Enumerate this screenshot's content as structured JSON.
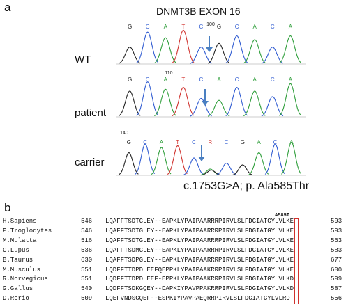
{
  "panel_a": {
    "letter": "a",
    "title": "DNMT3B EXON 16",
    "caption": "c.1753G>A; p. Ala585Thr",
    "traces": [
      {
        "label": "WT",
        "bases": [
          "G",
          "C",
          "A",
          "T",
          "C",
          "G",
          "C",
          "A",
          "C",
          "A"
        ],
        "position_marker": "100"
      },
      {
        "label": "patient",
        "bases": [
          "G",
          "C",
          "A",
          "T",
          "C",
          "A",
          "C",
          "A",
          "C",
          "A"
        ],
        "position_marker": "110"
      },
      {
        "label": "carrier",
        "bases": [
          "G",
          "C",
          "A",
          "T",
          "C",
          "R",
          "C",
          "G",
          "A",
          "C",
          "A"
        ],
        "position_marker": "140"
      }
    ],
    "base_colors": {
      "A": "#2e9e3a",
      "C": "#2f5bd1",
      "G": "#222222",
      "T": "#d0312d",
      "R": "#d0312d"
    }
  },
  "panel_b": {
    "letter": "b",
    "highlight_label": "A585T",
    "highlight_color": "#d0312d",
    "rows": [
      {
        "species": "H.Sapiens",
        "start": "546",
        "seq": "LQAFFTSDTGLEY--EAPKLYPAIPAARRRPIRVLSLFDGIATGYLVLKE",
        "end": "593"
      },
      {
        "species": "P.Troglodytes",
        "start": "546",
        "seq": "LQAFFTSDTGLEY--EAPKLYPAIPAARRRPIRVLSLFDGIATGYLVLKE",
        "end": "593"
      },
      {
        "species": "M.Mulatta",
        "start": "516",
        "seq": "LQAFFTSDTGLEY--EAPKLYPAIPAARRRPIRVLSLFDGIATGYLVLKE",
        "end": "563"
      },
      {
        "species": "C.Lupus",
        "start": "536",
        "seq": "LQAFFTSDMGLEY--EAPKLYPAIPAARRRPIRVLSLFDGIATGYLVLKE",
        "end": "583"
      },
      {
        "species": "B.Taurus",
        "start": "630",
        "seq": "LQAFFTSDPGLEY--EAPKLYPAIPAARRRPIRVLSLFDGIATGYLVLKE",
        "end": "677"
      },
      {
        "species": "M.Musculus",
        "start": "551",
        "seq": "LQDFFTTDPDLEEFQEPPKLYPAIPAAKRRPIRVLSLFDGIATGYLVLKE",
        "end": "600"
      },
      {
        "species": "R.Norvegicus",
        "start": "551",
        "seq": "LQDFFTTDPDLEEF-EPPKLYPAIPAAKRRPIRVLSLFDGIATGYLVLKD",
        "end": "599"
      },
      {
        "species": "G.Gallus",
        "start": "540",
        "seq": "LQDFFTSDKGQEY--DAPKIYPAVPPAKRRPIRVLSLFDGIATGYLVLKD",
        "end": "587"
      },
      {
        "species": "D.Rerio",
        "start": "509",
        "seq": "LQEFVNDSGQEF--ESPKIYPAVPAEQRRPIRVLSLFDGIATGYLVLRD",
        "end": "556"
      }
    ]
  }
}
